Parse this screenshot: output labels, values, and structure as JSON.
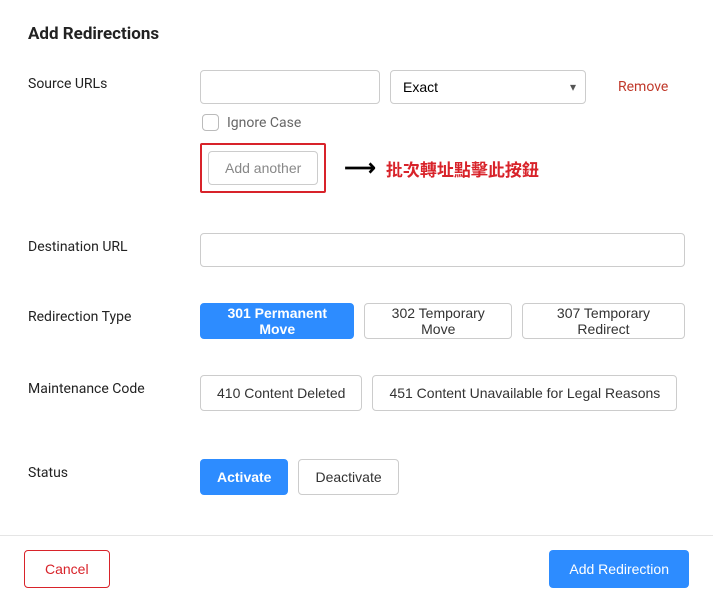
{
  "title": "Add Redirections",
  "source": {
    "label": "Source URLs",
    "match": {
      "selected": "Exact"
    },
    "remove_label": "Remove",
    "ignore_case_label": "Ignore Case",
    "add_another_label": "Add another",
    "annotation_text": "批次轉址點擊此按鈕"
  },
  "destination": {
    "label": "Destination URL"
  },
  "redirection_type": {
    "label": "Redirection Type",
    "options": [
      "301 Permanent Move",
      "302 Temporary Move",
      "307 Temporary Redirect"
    ],
    "selected_index": 0
  },
  "maintenance": {
    "label": "Maintenance Code",
    "options": [
      "410 Content Deleted",
      "451 Content Unavailable for Legal Reasons"
    ],
    "selected_index": -1
  },
  "status": {
    "label": "Status",
    "options": [
      "Activate",
      "Deactivate"
    ],
    "selected_index": 0
  },
  "footer": {
    "cancel_label": "Cancel",
    "submit_label": "Add Redirection"
  }
}
